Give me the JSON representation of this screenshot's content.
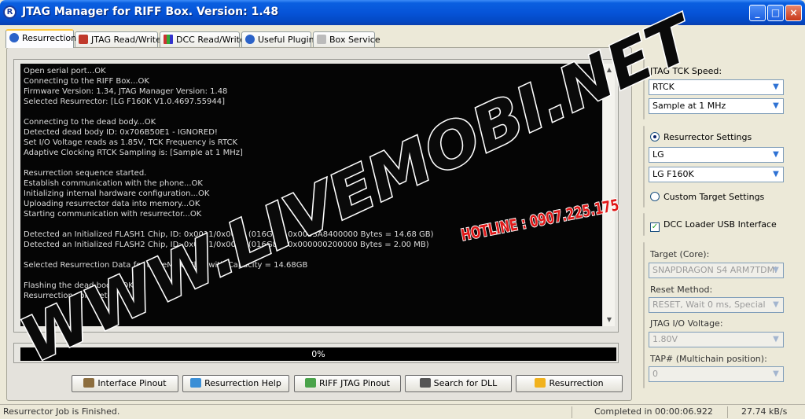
{
  "window": {
    "title": "JTAG Manager for RIFF Box. Version: 1.48",
    "icon_letter": "R",
    "controls": {
      "minimize": "_",
      "maximize": "□",
      "close": "×"
    }
  },
  "tabs": [
    {
      "label": "Resurrection",
      "icon": "info-icon"
    },
    {
      "label": "JTAG Read/Write",
      "icon": "chip-icon"
    },
    {
      "label": "DCC Read/Write",
      "icon": "books-icon"
    },
    {
      "label": "Useful Plugins",
      "icon": "info-icon"
    },
    {
      "label": "Box Service",
      "icon": "wrench-icon"
    }
  ],
  "log": [
    "Open serial port...OK",
    "Connecting to the RIFF Box...OK",
    "Firmware Version: 1.34, JTAG Manager Version: 1.48",
    "Selected Resurrector: [LG F160K V1.0.4697.55944]",
    "",
    "Connecting to the dead body...OK",
    "Detected dead body ID: 0x706B50E1 - IGNORED!",
    "Set I/O Voltage reads as 1.85V, TCK Frequency is RTCK",
    "Adaptive Clocking RTCK Sampling is: [Sample at 1 MHz]",
    "",
    "Resurrection sequence started.",
    "Establish communication with the phone...OK",
    "Initializing internal hardware configuration...OK",
    "Uploading resurrector data into memory...OK",
    "Starting communication with resurrector...OK",
    "",
    "Detected an Initialized FLASH1 Chip, ID: 0x0011/0x0000 (016G8B, 0x0003A8400000 Bytes = 14.68 GB)",
    "Detected an Initialized FLASH2 Chip, ID: 0x0011/0x0000 (016G8B, 0x000000200000 Bytes = 2.00 MB)",
    "",
    "Selected Resurrection Data for the eMMC Chip with Capacity = 14.68GB",
    "",
    "Flashing the dead body...OK",
    "Resurrection complete!"
  ],
  "progress": {
    "label": "0%",
    "value": 0
  },
  "buttons": [
    {
      "label": "Interface Pinout",
      "icon": "box-icon"
    },
    {
      "label": "Resurrection Help",
      "icon": "help-book-icon"
    },
    {
      "label": "RIFF JTAG Pinout",
      "icon": "pencil-icon"
    },
    {
      "label": "Search for DLL",
      "icon": "binoculars-icon"
    },
    {
      "label": "Resurrection",
      "icon": "lightning-icon"
    }
  ],
  "settings": {
    "tck_speed_label": "JTAG TCK Speed:",
    "tck_speed_value": "RTCK",
    "sampling_value": "Sample at 1 MHz",
    "resurrector_settings_label": "Resurrector Settings",
    "manufacturer_value": "LG",
    "model_value": "LG F160K",
    "custom_target_label": "Custom Target Settings",
    "dcc_loader_label": "DCC Loader USB Interface",
    "target_core_label": "Target (Core):",
    "target_core_value": "SNAPDRAGON S4 ARM7TDMI",
    "reset_method_label": "Reset Method:",
    "reset_method_value": "RESET, Wait 0 ms, Special",
    "io_voltage_label": "JTAG I/O Voltage:",
    "io_voltage_value": "1.80V",
    "tap_label": "TAP# (Multichain position):",
    "tap_value": "0"
  },
  "status": {
    "message": "Resurrector Job is Finished.",
    "elapsed": "Completed in 00:00:06.922",
    "speed": "27.74 kB/s"
  },
  "watermark": {
    "site": "WWW.LIVEMOBI.NET",
    "hotline": "HOTLINE : 0907.225.175"
  },
  "colors": {
    "title_bar": "#0654d8",
    "log_background": "#050505",
    "log_text": "#dcdcdc",
    "watermark_red": "#e01818",
    "checkbox_check": "#21a121"
  }
}
